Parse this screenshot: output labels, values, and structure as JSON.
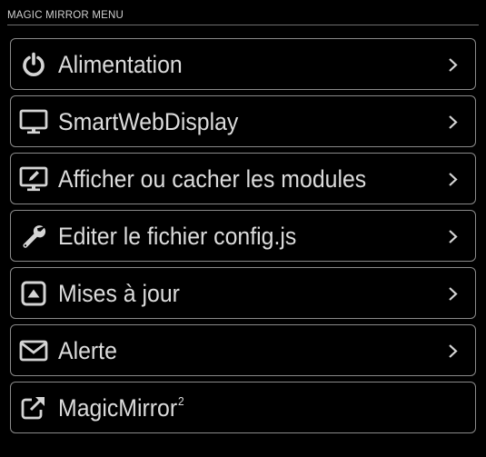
{
  "header": {
    "title": "MAGIC MIRROR MENU"
  },
  "menu": {
    "items": [
      {
        "label": "Alimentation",
        "icon": "power-icon",
        "has_chevron": true
      },
      {
        "label": "SmartWebDisplay",
        "icon": "monitor-icon",
        "has_chevron": true
      },
      {
        "label": "Afficher ou cacher les modules",
        "icon": "desktop-edit-icon",
        "has_chevron": true
      },
      {
        "label": "Editer le fichier config.js",
        "icon": "wrench-icon",
        "has_chevron": true
      },
      {
        "label": "Mises à jour",
        "icon": "upload-square-icon",
        "has_chevron": true
      },
      {
        "label": "Alerte",
        "icon": "envelope-icon",
        "has_chevron": true
      },
      {
        "label": "MagicMirror",
        "superscript": "2",
        "icon": "external-link-icon",
        "has_chevron": false
      }
    ]
  },
  "colors": {
    "background": "#000000",
    "text": "#dcdcdc",
    "border": "#8a8a8a",
    "icon": "#d4d4d4"
  }
}
